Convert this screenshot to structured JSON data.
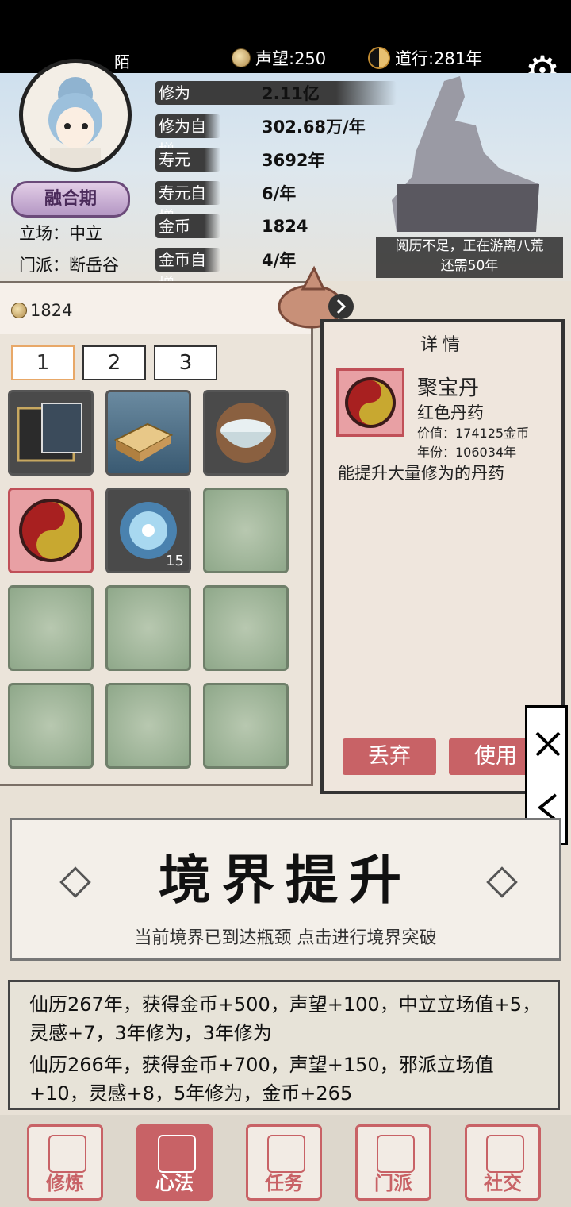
{
  "top": {
    "player_name": "陌",
    "reputation": "声望:250",
    "daoxing": "道行:281年"
  },
  "profile": {
    "realm_badge": "融合期",
    "stance": "立场：中立",
    "sect": "门派：断岳谷"
  },
  "stats": [
    {
      "label": "修为",
      "value": "2.11亿"
    },
    {
      "label": "修为自增",
      "value": "302.68万/年"
    },
    {
      "label": "寿元",
      "value": "3692年"
    },
    {
      "label": "寿元自增",
      "value": "6/年"
    },
    {
      "label": "金币",
      "value": "1824"
    },
    {
      "label": "金币自增",
      "value": "4/年"
    }
  ],
  "wander": {
    "line1": "阅历不足，正在游离八荒",
    "line2": "还需50年"
  },
  "inventory": {
    "coins": "1824",
    "tabs": [
      "1",
      "2",
      "3"
    ],
    "slots": [
      {
        "icon": "book-icon",
        "count": ""
      },
      {
        "icon": "gold-ingot-icon",
        "count": ""
      },
      {
        "icon": "glowing-bowl-icon",
        "count": ""
      },
      {
        "icon": "red-pill-icon",
        "count": ""
      },
      {
        "icon": "water-orb-icon",
        "count": "15"
      },
      {
        "icon": "",
        "count": ""
      },
      {
        "icon": "",
        "count": ""
      },
      {
        "icon": "",
        "count": ""
      },
      {
        "icon": "",
        "count": ""
      },
      {
        "icon": "",
        "count": ""
      },
      {
        "icon": "",
        "count": ""
      },
      {
        "icon": "",
        "count": ""
      }
    ]
  },
  "detail": {
    "title": "详情",
    "name": "聚宝丹",
    "type": "红色丹药",
    "price": "价值：174125金币",
    "age": "年份：106034年",
    "desc": "能提升大量修为的丹药",
    "discard": "丢弃",
    "use": "使用"
  },
  "realm": {
    "title": "境界提升",
    "subtitle": "当前境界已到达瓶颈 点击进行境界突破"
  },
  "log": [
    "仙历267年，获得金币+500，声望+100，中立立场值+5，灵感+7，3年修为，3年修为",
    "仙历266年，获得金币+700，声望+150，邪派立场值+10，灵感+8，5年修为，金币+265"
  ],
  "nav": [
    "修炼",
    "心法",
    "任务",
    "门派",
    "社交"
  ],
  "colors": {
    "accent": "#c86266",
    "panel": "#efe6dd"
  }
}
